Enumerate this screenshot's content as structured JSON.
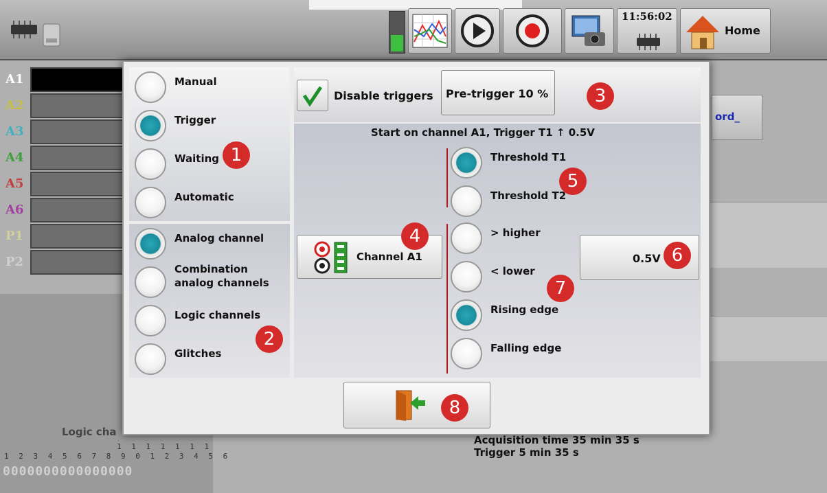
{
  "topbar": {
    "clock": "11:56:02",
    "home_label": "Home"
  },
  "background": {
    "channels": [
      {
        "label": "A1",
        "color": "#ffffff"
      },
      {
        "label": "A2",
        "color": "#c8c040"
      },
      {
        "label": "A3",
        "color": "#40b0c0"
      },
      {
        "label": "A4",
        "color": "#40a040"
      },
      {
        "label": "A5",
        "color": "#c04040"
      },
      {
        "label": "A6",
        "color": "#a040a0"
      },
      {
        "label": "P1",
        "color": "#d0d0a0"
      },
      {
        "label": "P2",
        "color": "#d0d0d0"
      }
    ],
    "logic_label": "Logic cha",
    "logic_numbers_top": "1 1 1 1 1 1 1",
    "logic_numbers": "1 2 3 4 5 6 7 8 9 0 1 2 3 4 5 6",
    "logic_values": "0000000000000000",
    "acquisition_time": "Acquisition time 35 min 35 s",
    "trigger_time": "Trigger  5 min 35 s",
    "record_label": "ord_"
  },
  "dialog": {
    "modes": [
      {
        "label": "Manual",
        "selected": false
      },
      {
        "label": "Trigger",
        "selected": true
      },
      {
        "label": "Waiting",
        "selected": false
      },
      {
        "label": "Automatic",
        "selected": false
      }
    ],
    "sources": [
      {
        "label": "Analog channel",
        "selected": true
      },
      {
        "label": "Combination analog channels",
        "selected": false
      },
      {
        "label": "Logic channels",
        "selected": false
      },
      {
        "label": "Glitches",
        "selected": false
      }
    ],
    "disable_triggers": "Disable triggers",
    "pretrigger": "Pre-trigger 10 %",
    "summary": "Start on channel A1, Trigger T1 ↑ 0.5V",
    "thresholds": [
      {
        "label": "Threshold T1",
        "selected": true
      },
      {
        "label": "Threshold T2",
        "selected": false
      }
    ],
    "channel_button": "Channel A1",
    "conditions": [
      {
        "label": "> higher",
        "selected": false
      },
      {
        "label": "< lower",
        "selected": false
      },
      {
        "label": "Rising edge",
        "selected": true
      },
      {
        "label": "Falling edge",
        "selected": false
      }
    ],
    "value": "0.5V",
    "badges": [
      "1",
      "2",
      "3",
      "4",
      "5",
      "6",
      "7",
      "8"
    ]
  },
  "colors": {
    "accent": "#1a8c9c",
    "badge": "#d42a2a",
    "check": "#1f8f2a"
  }
}
